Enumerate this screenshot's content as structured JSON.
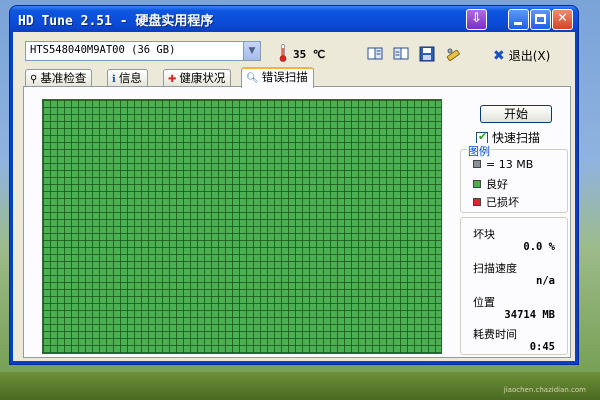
{
  "window": {
    "title": "HD Tune 2.51 - 硬盘实用程序"
  },
  "toolbar": {
    "drive": "HTS548040M9AT00 (36 GB)",
    "temperature": "35 ℃",
    "exit_label": "退出(X)"
  },
  "tabs": [
    {
      "label": "基准检查",
      "icon": "benchmark-icon",
      "active": false
    },
    {
      "label": "信息",
      "icon": "info-icon",
      "active": false
    },
    {
      "label": "健康状况",
      "icon": "health-cross-icon",
      "active": false
    },
    {
      "label": "错误扫描",
      "icon": "magnifier-icon",
      "active": true
    }
  ],
  "scan": {
    "start_label": "开始",
    "quick_scan_label": "快速扫描",
    "quick_scan_checked": true,
    "legend": {
      "title": "图例",
      "items": [
        {
          "label": "= 13 MB",
          "color": "#8a8f99"
        },
        {
          "label": "良好",
          "color": "#45b24a"
        },
        {
          "label": "已损坏",
          "color": "#e0242b"
        }
      ]
    },
    "stats": [
      {
        "label": "坏块",
        "value": "0.0 %"
      },
      {
        "label": "扫描速度",
        "value": "n/a"
      },
      {
        "label": "位置",
        "value": "34714 MB"
      },
      {
        "label": "耗费时间",
        "value": "0:45"
      }
    ],
    "grid_color": "#4bb150"
  },
  "watermark": "jiaochen.chazidian.com"
}
